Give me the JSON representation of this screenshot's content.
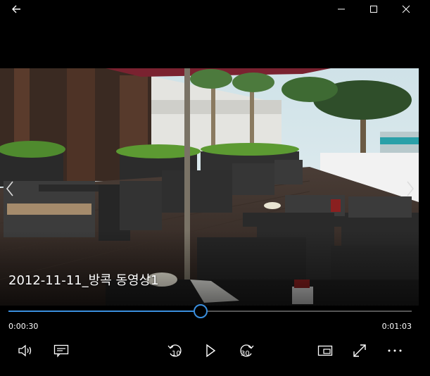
{
  "window": {
    "controls": {
      "back": "back-arrow-icon",
      "minimize": "minimize-icon",
      "maximize": "maximize-icon",
      "close": "close-icon"
    }
  },
  "video": {
    "title": "2012-11-11_방콕 동영상1"
  },
  "playback": {
    "elapsed": "0:00:30",
    "total": "0:01:03",
    "progress_fraction": 0.476
  },
  "controls": {
    "skip_back_seconds": "10",
    "skip_forward_seconds": "30",
    "icons": [
      "volume-icon",
      "subtitles-icon",
      "skip-back-icon",
      "play-icon",
      "skip-forward-icon",
      "mini-view-icon",
      "fullscreen-icon",
      "more-icon"
    ]
  },
  "colors": {
    "accent": "#3a8fde",
    "background": "#000000",
    "track": "#555555"
  }
}
